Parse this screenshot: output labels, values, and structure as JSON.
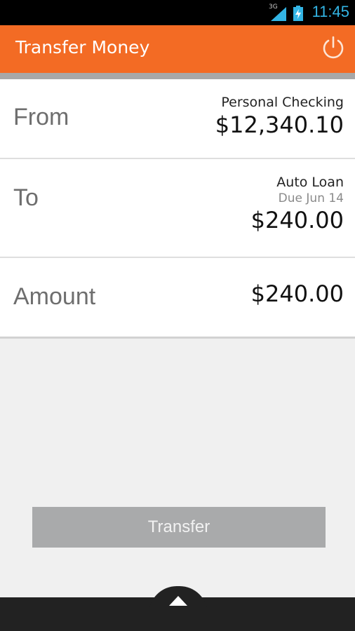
{
  "status_bar": {
    "network": "3G",
    "time": "11:45",
    "icons": [
      "signal-icon",
      "battery-charging-icon"
    ],
    "clock_color": "#33b5e5"
  },
  "app_bar": {
    "title": "Transfer Money",
    "background": "#f36b24",
    "action_icon": "power-icon"
  },
  "form": {
    "from": {
      "label": "From",
      "account": "Personal Checking",
      "balance": "$12,340.10"
    },
    "to": {
      "label": "To",
      "account": "Auto Loan",
      "due": "Due Jun 14",
      "amount": "$240.00"
    },
    "amount": {
      "label": "Amount",
      "value": "$240.00"
    }
  },
  "transfer_button": {
    "label": "Transfer"
  },
  "bottom_bar": {
    "handle_icon": "chevron-up-icon"
  }
}
